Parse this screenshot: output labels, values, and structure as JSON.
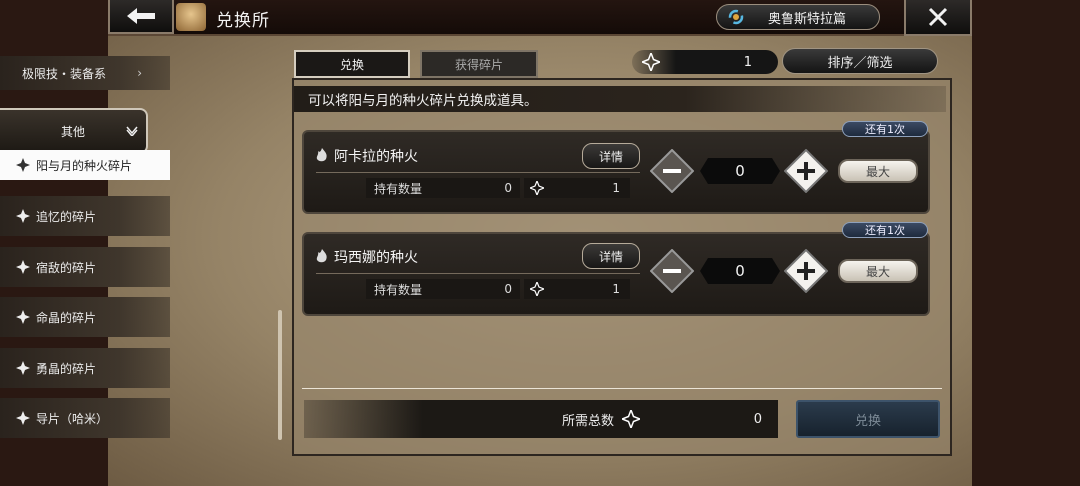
{
  "header": {
    "title": "兑换所",
    "world_label": "奥鲁斯特拉篇"
  },
  "sidebar": {
    "items": [
      {
        "label": "极限技・装备系"
      },
      {
        "label": "其他"
      },
      {
        "label": "阳与月的种火碎片"
      },
      {
        "label": "追忆的碎片"
      },
      {
        "label": "宿敌的碎片"
      },
      {
        "label": "命晶的碎片"
      },
      {
        "label": "勇晶的碎片"
      },
      {
        "label": "导片（哈米）"
      }
    ]
  },
  "tabs": [
    {
      "label": "兑换"
    },
    {
      "label": "获得碎片"
    }
  ],
  "currency": {
    "value": "1"
  },
  "sort_label": "排序／筛选",
  "description": "可以将阳与月的种火碎片兑换成道具。",
  "items": [
    {
      "name": "阿卡拉的种火",
      "remaining": "还有1次",
      "detail_label": "详情",
      "hold_label": "持有数量",
      "hold_value": "0",
      "cost": "1",
      "quantity": "0",
      "max_label": "最大"
    },
    {
      "name": "玛西娜的种火",
      "remaining": "还有1次",
      "detail_label": "详情",
      "hold_label": "持有数量",
      "hold_value": "0",
      "cost": "1",
      "quantity": "0",
      "max_label": "最大"
    }
  ],
  "total": {
    "label": "所需总数",
    "value": "0"
  },
  "exchange_button": "兑换",
  "colors": {
    "accent_blue": "#2b3b4c",
    "parchment": "#a8967a"
  }
}
